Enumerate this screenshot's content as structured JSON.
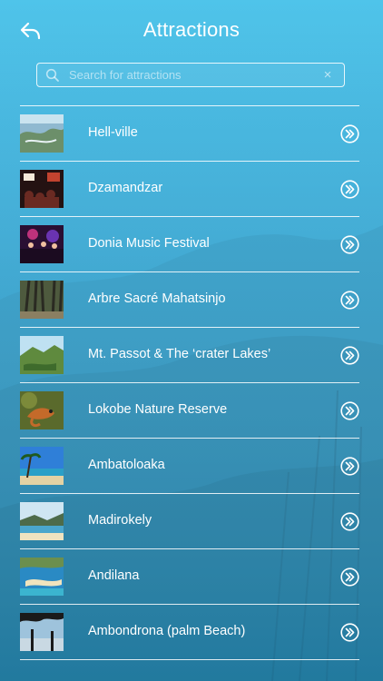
{
  "header": {
    "title": "Attractions",
    "back_icon": "back-arrow-icon"
  },
  "search": {
    "placeholder": "Search for attractions",
    "value": "",
    "search_icon": "search-icon",
    "clear_icon": "clear-icon",
    "clear_glyph": "×"
  },
  "colors": {
    "background_top": "#4fc4ea",
    "background_bottom": "#2a8fb9",
    "text": "#ffffff",
    "divider": "#ffffff"
  },
  "attractions": [
    {
      "label": "Hell-ville",
      "thumb_icon": "aerial-coast-thumbnail",
      "action_icon": "double-chevron-right-icon"
    },
    {
      "label": "Dzamandzar",
      "thumb_icon": "night-crowd-thumbnail",
      "action_icon": "double-chevron-right-icon"
    },
    {
      "label": "Donia Music Festival",
      "thumb_icon": "concert-stage-thumbnail",
      "action_icon": "double-chevron-right-icon"
    },
    {
      "label": "Arbre Sacré Mahatsinjo",
      "thumb_icon": "sacred-tree-thumbnail",
      "action_icon": "double-chevron-right-icon"
    },
    {
      "label": "Mt. Passot & The ‘crater Lakes’",
      "thumb_icon": "mountain-lake-thumbnail",
      "action_icon": "double-chevron-right-icon"
    },
    {
      "label": "Lokobe Nature Reserve",
      "thumb_icon": "chameleon-thumbnail",
      "action_icon": "double-chevron-right-icon"
    },
    {
      "label": "Ambatoloaka",
      "thumb_icon": "beach-palms-thumbnail",
      "action_icon": "double-chevron-right-icon"
    },
    {
      "label": "Madirokely",
      "thumb_icon": "bay-hills-thumbnail",
      "action_icon": "double-chevron-right-icon"
    },
    {
      "label": "Andilana",
      "thumb_icon": "sandbar-beach-thumbnail",
      "action_icon": "double-chevron-right-icon"
    },
    {
      "label": "Ambondrona (palm Beach)",
      "thumb_icon": "sunset-palms-thumbnail",
      "action_icon": "double-chevron-right-icon"
    }
  ]
}
